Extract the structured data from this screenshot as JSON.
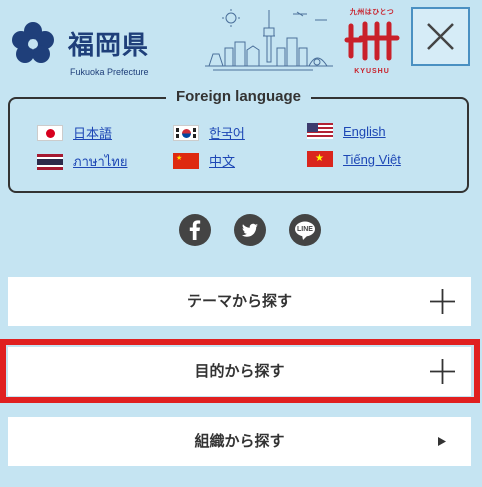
{
  "header": {
    "logo_text": "福岡県",
    "logo_subtitle": "Fukuoka Prefecture",
    "kyushu_top": "九州はひとつ",
    "kyushu_bottom": "KYUSHU",
    "close_icon": "close-icon"
  },
  "languages": {
    "title": "Foreign language",
    "items": [
      {
        "label": "日本語",
        "flag": "japan-flag"
      },
      {
        "label": "한국어",
        "flag": "korea-flag"
      },
      {
        "label": "English",
        "flag": "usa-flag"
      },
      {
        "label": "ภาษาไทย",
        "flag": "thailand-flag"
      },
      {
        "label": "中文",
        "flag": "china-flag"
      },
      {
        "label": "Tiếng Việt",
        "flag": "vietnam-flag"
      }
    ]
  },
  "social": {
    "icons": [
      "facebook-icon",
      "twitter-icon",
      "line-icon"
    ],
    "line_text": "LINE"
  },
  "menu": {
    "items": [
      {
        "label": "テーマから探す",
        "icon": "plus-icon"
      },
      {
        "label": "目的から探す",
        "icon": "plus-icon"
      },
      {
        "label": "組織から探す",
        "icon": "triangle-right-icon"
      }
    ]
  },
  "colors": {
    "background": "#c5e4f2",
    "highlight": "#e02020",
    "link": "#1d47b5",
    "logo": "#1f3f7a"
  }
}
